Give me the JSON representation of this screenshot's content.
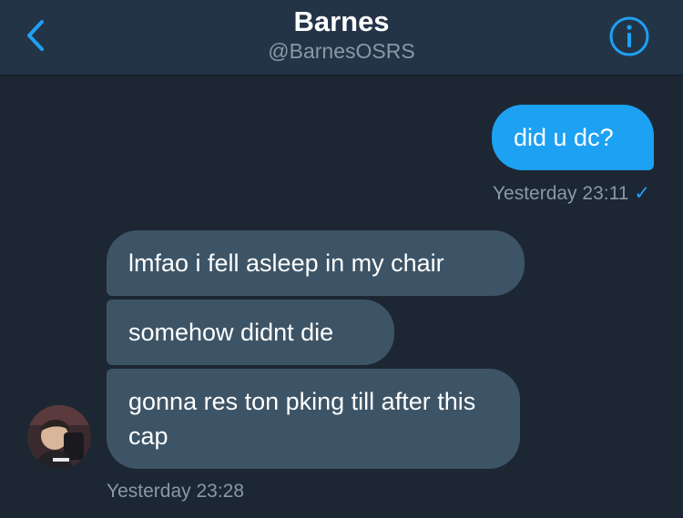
{
  "header": {
    "title": "Barnes",
    "handle": "@BarnesOSRS",
    "back_icon": "chevron-left-icon",
    "info_icon": "info-icon"
  },
  "colors": {
    "background": "#1c2733",
    "header": "#243447",
    "accent": "#1da1f2",
    "incoming_bubble": "#3d5466",
    "muted_text": "#8899a6"
  },
  "conversation": {
    "outgoing": {
      "text": "did u dc?",
      "timestamp": "Yesterday 23:11",
      "status": "✓"
    },
    "incoming": [
      {
        "text": "lmfao i fell asleep in my chair"
      },
      {
        "text": "somehow didnt die"
      },
      {
        "text": "gonna res ton pking till after this cap"
      }
    ],
    "incoming_timestamp": "Yesterday 23:28",
    "avatar_icon": "user-avatar"
  }
}
